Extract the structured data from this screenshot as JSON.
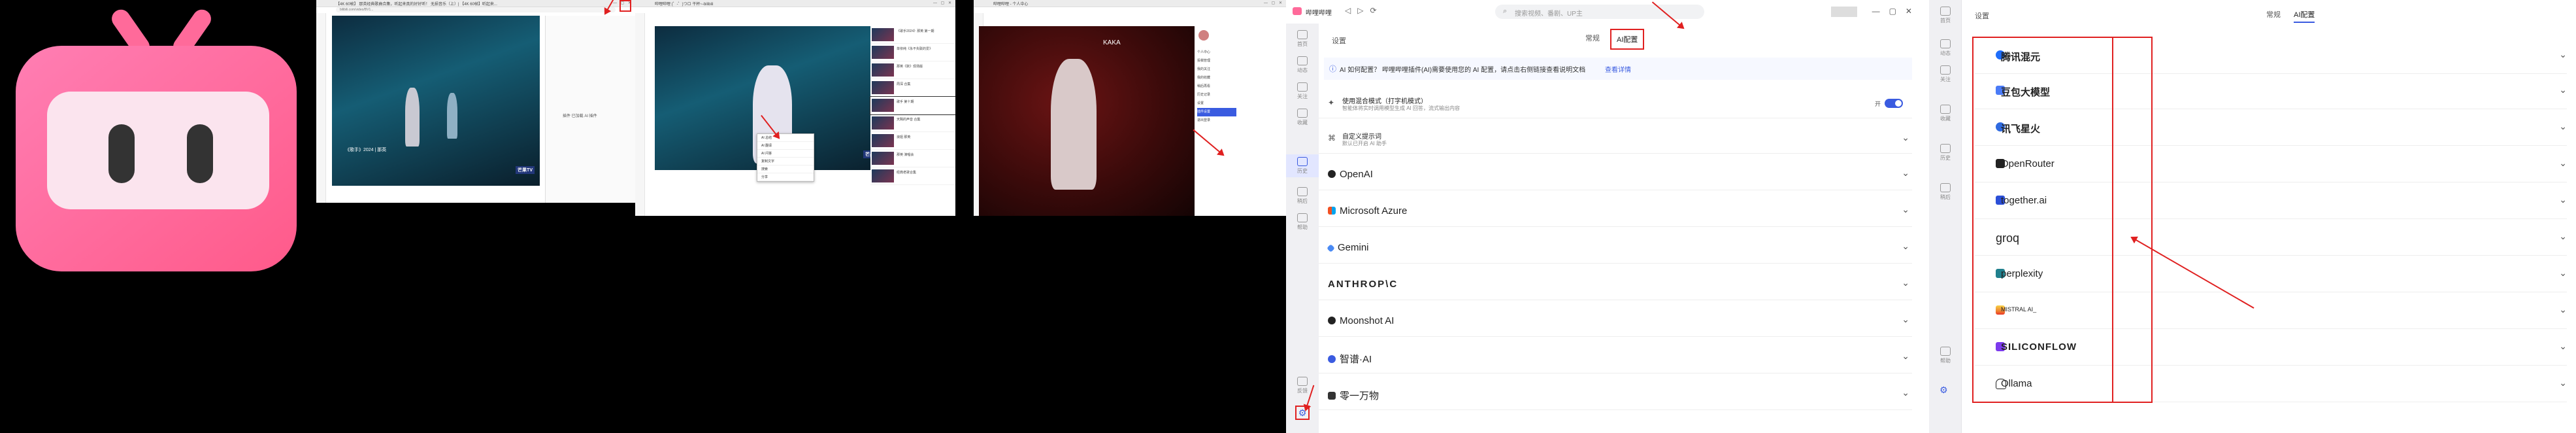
{
  "capture1": {
    "tab_title": "【4K 60帧】 那英经典歌曲合集，听起来真的好好听！ 无损音乐（上）| 【4K 60帧】听起来...",
    "address": "bilibili.com/video/BV1...",
    "video_caption": "《歌手》2024 | 那英",
    "video_logo": "芒果TV",
    "popup_text": "插件 已加载 AI 插件"
  },
  "capture2": {
    "tab_title": "哔哩哔哩 (゜-゜)つロ 干杯~-bilibili",
    "video_logo": "芒果TV",
    "context_menu": [
      "AI 总结",
      "AI 翻译",
      "AI 问答",
      "复制文字",
      "搜索",
      "分享"
    ],
    "side_items": [
      "《歌手2024》那英 第一期",
      "单依纯《永不失联的爱》",
      "那英《默》现场版",
      "周深 合集",
      "歌手 第十期",
      "天赐的声音 合集",
      "浪姐 那英",
      "那英 演唱会",
      "经典老歌合集"
    ]
  },
  "capture3": {
    "tab_title": "哔哩哔哩 - 个人中心",
    "video_caption": "KAKA",
    "menu_items": [
      "个人中心",
      "投稿管理",
      "我的关注",
      "我的收藏",
      "稍后再看",
      "历史记录",
      "设置",
      "插件设置",
      "退出登录"
    ]
  },
  "app": {
    "title": "哔哩哔哩",
    "search_placeholder": "搜索视频、番剧、UP主",
    "breadcrumb": "设置",
    "tabs": [
      "常规",
      "AI配置"
    ],
    "info_text": "AI 如何配置？ 哔哩哔哩插件(AI)需要使用您的 AI 配置，请点击右侧链接查看说明文档",
    "info_link": "查看详情",
    "mode_title": "使用混合模式（打字机模式）",
    "mode_desc": "智能体将实时调用模型生成 AI 回答，流式输出内容",
    "toggle_label": "开",
    "prompt_title": "自定义提示词",
    "prompt_desc": "默认已开启 AI 助手",
    "providers": [
      "OpenAI",
      "Microsoft Azure",
      "Gemini",
      "ANTHROP\\C",
      "Moonshot AI",
      "智谱·AI",
      "零一万物"
    ],
    "rail": [
      "首页",
      "动态",
      "关注",
      "收藏",
      "历史",
      "稍后",
      "帮助",
      "反馈"
    ],
    "accent": "#e02020"
  },
  "panel": {
    "breadcrumb": "设置",
    "tabs": [
      "常规",
      "AI配置"
    ],
    "providers": [
      "腾讯混元",
      "豆包大模型",
      "讯飞星火",
      "OpenRouter",
      "together.ai",
      "groq",
      "perplexity",
      "MISTRAL AI_",
      "SILICONFLOW",
      "Ollama"
    ],
    "rail": [
      "首页",
      "动态",
      "关注",
      "收藏",
      "历史",
      "稍后",
      "帮助"
    ]
  }
}
